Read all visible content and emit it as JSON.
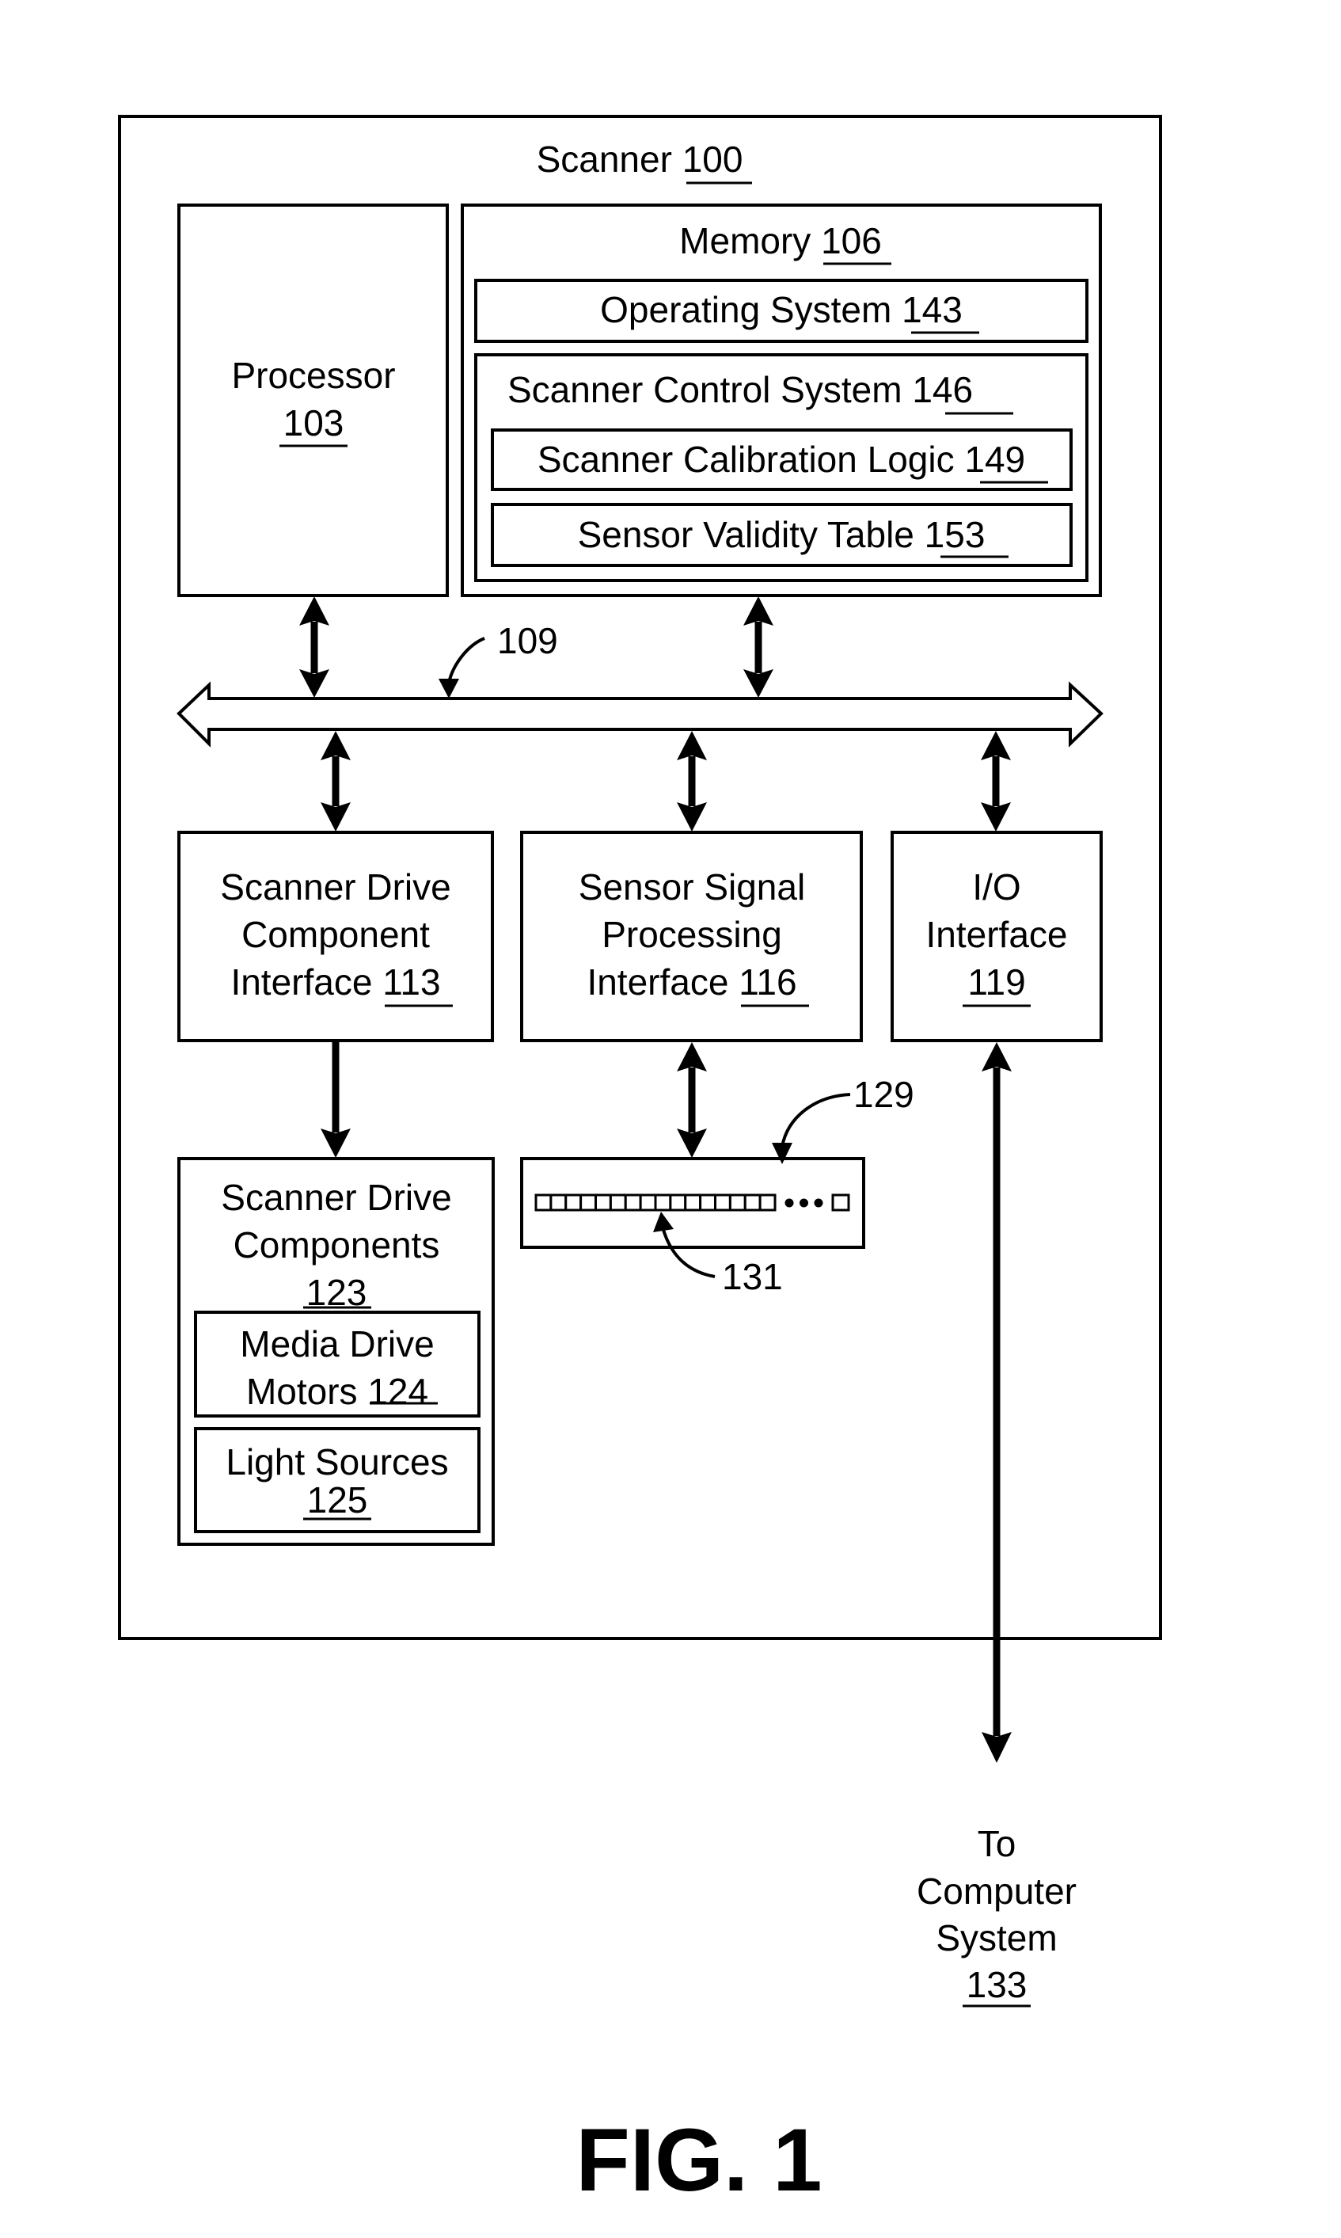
{
  "figure": {
    "caption": "FIG. 1",
    "scanner": {
      "label": "Scanner",
      "ref": "100"
    },
    "processor": {
      "lines": [
        "Processor"
      ],
      "ref": "103"
    },
    "memory": {
      "label": "Memory",
      "ref": "106"
    },
    "operating_system": {
      "label": "Operating System",
      "ref": "143"
    },
    "scanner_control_system": {
      "label": "Scanner Control System",
      "ref": "146"
    },
    "scanner_calibration_logic": {
      "label": "Scanner Calibration Logic",
      "ref": "149"
    },
    "sensor_validity_table": {
      "label": "Sensor Validity Table",
      "ref": "153"
    },
    "bus": {
      "ref": "109"
    },
    "scanner_drive_component_interface": {
      "lines": [
        "Scanner Drive",
        "Component",
        "Interface"
      ],
      "ref": "113"
    },
    "sensor_signal_processing_interface": {
      "lines": [
        "Sensor Signal",
        "Processing",
        "Interface"
      ],
      "ref": "116"
    },
    "io_interface": {
      "lines": [
        "I/O",
        "Interface"
      ],
      "ref": "119"
    },
    "scanner_drive_components": {
      "lines": [
        "Scanner Drive",
        "Components"
      ],
      "ref": "123"
    },
    "media_drive_motors": {
      "lines": [
        "Media Drive",
        "Motors"
      ],
      "ref": "124"
    },
    "light_sources": {
      "lines": [
        "Light Sources"
      ],
      "ref": "125"
    },
    "sensor_array": {
      "ref": "129",
      "sensor_ref": "131",
      "cell_count": 16,
      "ellipsis_dots": 3
    },
    "computer_system": {
      "lines": [
        "To",
        "Computer",
        "System"
      ],
      "ref": "133"
    }
  }
}
